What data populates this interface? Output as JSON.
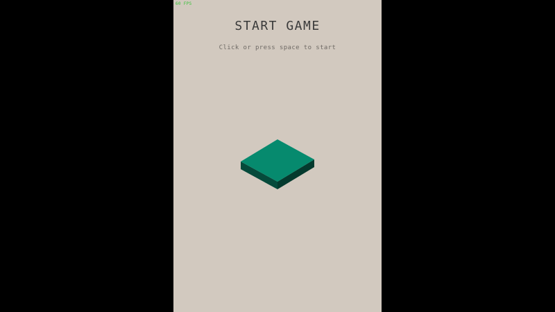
{
  "hud": {
    "fps_text": "60 FPS"
  },
  "menu": {
    "title": "START GAME",
    "subtitle": "Click or press space to start"
  },
  "colors": {
    "background_outer": "#000000",
    "game_background": "#d2c9bf",
    "block_top": "#068a6e",
    "block_left": "#054a3b",
    "block_right": "#043a2e",
    "title_text": "#3a3a3a",
    "subtitle_text": "#6f6a65",
    "fps_text": "#39c23a"
  },
  "scene": {
    "block_count": 1
  }
}
